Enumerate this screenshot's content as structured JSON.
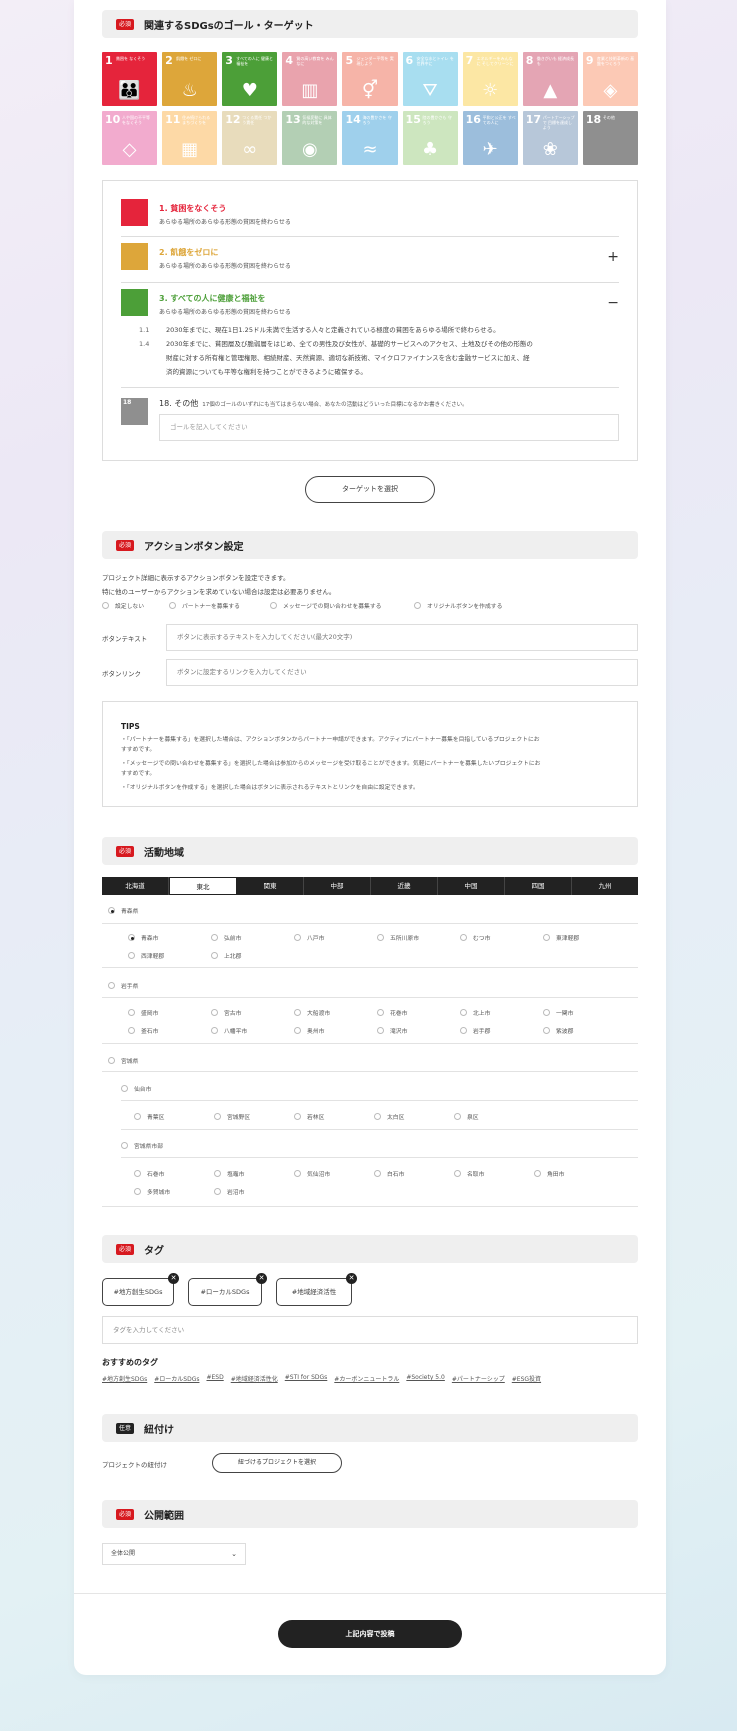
{
  "sections": {
    "sdgs": {
      "badge": "必須",
      "title": "関連するSDGsのゴール・ターゲット"
    },
    "action": {
      "badge": "必須",
      "title": "アクションボタン設定"
    },
    "area": {
      "badge": "必須",
      "title": "活動地域"
    },
    "tags": {
      "badge": "必須",
      "title": "タグ"
    },
    "link": {
      "badge": "任意",
      "title": "紐付け"
    },
    "visibility": {
      "badge": "必須",
      "title": "公開範囲"
    }
  },
  "sdg_tiles": [
    {
      "num": "1",
      "label": "貧困を なくそう",
      "glyph": "👪",
      "color": "#e5243b"
    },
    {
      "num": "2",
      "label": "飢餓を ゼロに",
      "glyph": "♨",
      "color": "#dda63a"
    },
    {
      "num": "3",
      "label": "すべての人に 健康と福祉を",
      "glyph": "♥",
      "color": "#4c9f38"
    },
    {
      "num": "4",
      "label": "質の高い教育を みんなに",
      "glyph": "▥",
      "color": "#e9a3ad"
    },
    {
      "num": "5",
      "label": "ジェンダー平等を 実現しよう",
      "glyph": "⚥",
      "color": "#f6b4a8"
    },
    {
      "num": "6",
      "label": "安全な水とトイレ を世界中に",
      "glyph": "⛛",
      "color": "#a8def0"
    },
    {
      "num": "7",
      "label": "エネルギーをみんなに そしてクリーンに",
      "glyph": "☼",
      "color": "#fce7a4"
    },
    {
      "num": "8",
      "label": "働きがいも 経済成長も",
      "glyph": "▲",
      "color": "#e4a5b4"
    },
    {
      "num": "9",
      "label": "産業と技術革新の 基盤をつくろう",
      "glyph": "◈",
      "color": "#fcc9b5"
    },
    {
      "num": "10",
      "label": "人や国の不平等 をなくそう",
      "glyph": "◇",
      "color": "#f2abce"
    },
    {
      "num": "11",
      "label": "住み続けられる まちづくりを",
      "glyph": "▦",
      "color": "#fdd9a6"
    },
    {
      "num": "12",
      "label": "つくる責任 つかう責任",
      "glyph": "∞",
      "color": "#e8dcbc"
    },
    {
      "num": "13",
      "label": "気候変動に 具体的な対策を",
      "glyph": "◉",
      "color": "#b3cfb4"
    },
    {
      "num": "14",
      "label": "海の豊かさを 守ろう",
      "glyph": "≈",
      "color": "#9fd0ec"
    },
    {
      "num": "15",
      "label": "陸の豊かさも 守ろう",
      "glyph": "♣",
      "color": "#cde6bf"
    },
    {
      "num": "16",
      "label": "平和と公正を すべての人に",
      "glyph": "✈",
      "color": "#9cbedc"
    },
    {
      "num": "17",
      "label": "パートナーシップで 目標を達成しよう",
      "glyph": "❀",
      "color": "#b7c7d9"
    },
    {
      "num": "18",
      "label": "その他",
      "glyph": "",
      "color": "#8f8f8f"
    }
  ],
  "goals": [
    {
      "title": "1. 貧困をなくそう",
      "sub": "あらゆる場所のあらゆる形態の貧困を終わらせる",
      "color": "#e5243b",
      "toggle": ""
    },
    {
      "title": "2. 飢餓をゼロに",
      "sub": "あらゆる場所のあらゆる形態の貧困を終わらせる",
      "color": "#dda63a",
      "toggle": "+"
    },
    {
      "title": "3. すべての人に健康と福祉を",
      "sub": "あらゆる場所のあらゆる形態の貧困を終わらせる",
      "color": "#4c9f38",
      "toggle": "−"
    }
  ],
  "targets": [
    {
      "id": "1.1",
      "lines": [
        "2030年までに、現在1日1.25ドル未満で生活する人々と定義されている極度の貧困をあらゆる場所で終わらせる。"
      ]
    },
    {
      "id": "1.4",
      "lines": [
        "2030年までに、貧困層及び脆弱層をはじめ、全ての男性及び女性が、基礎的サービスへのアクセス、土地及びその他の形態の",
        "財産に対する所有権と管理権限、相続財産、天然資源、適切な新技術、マイクロファイナンスを含む金融サービスに加え、経",
        "済的資源についても平等な権利を持つことができるように確保する。"
      ]
    }
  ],
  "other_goal": {
    "tile": "18",
    "title": "18. その他",
    "note": "17個のゴールのいずれにも当てはまらない場合、あなたの活動はどういった目標になるかお書きください。",
    "placeholder": "ゴールを記入してください"
  },
  "select_target_button": "ターゲットを選択",
  "action": {
    "desc1": "プロジェクト詳細に表示するアクションボタンを設定できます。",
    "desc2": "特に他のユーザーからアクションを求めていない場合は設定は必要ありません。",
    "options": [
      "設定しない",
      "パートナーを募集する",
      "メッセージでの問い合わせを募集する",
      "オリジナルボタンを作成する"
    ],
    "text_label": "ボタンテキスト",
    "text_placeholder": "ボタンに表示するテキストを入力してください(最大20文字)",
    "link_label": "ボタンリンク",
    "link_placeholder": "ボタンに設定するリンクを入力してください"
  },
  "tips": {
    "title": "TIPS",
    "lines": [
      "・「パートナーを募集する」を選択した場合は、アクションボタンからパートナー申請ができます。アクティブにパートナー募集を目指しているプロジェクトにお",
      "すすめです。",
      "・「メッセージでの問い合わせを募集する」を選択した場合は参加からのメッセージを受け取ることができます。気軽にパートナーを募集したいプロジェクトにお",
      "すすめです。",
      "・「オリジナルボタンを作成する」を選択した場合はボタンに表示されるテキストとリンクを自由に設定できます。"
    ]
  },
  "regions": [
    "北海道",
    "東北",
    "関東",
    "中部",
    "近畿",
    "中国",
    "四国",
    "九州"
  ],
  "prefectures": {
    "aomori": {
      "name": "青森県",
      "cities": [
        "青森市",
        "弘前市",
        "八戸市",
        "五所川原市",
        "むつ市",
        "東津軽郡",
        "西津軽郡",
        "上北郡"
      ]
    },
    "iwate": {
      "name": "岩手県",
      "cities": [
        "盛岡市",
        "宮古市",
        "大船渡市",
        "花巻市",
        "北上市",
        "一関市",
        "釜石市",
        "八幡平市",
        "奥州市",
        "滝沢市",
        "岩手郡",
        "紫波郡"
      ]
    },
    "miyagi": {
      "name": "宮城県",
      "sendai": "仙台市",
      "sendai_wards": [
        "青葉区",
        "宮城野区",
        "若林区",
        "太白区",
        "泉区"
      ],
      "other_label": "宮城県市部",
      "other_cities": [
        "石巻市",
        "塩竈市",
        "気仙沼市",
        "白石市",
        "名取市",
        "角田市",
        "多賀城市",
        "岩沼市"
      ]
    }
  },
  "tags": {
    "chips": [
      "#地方創生SDGs",
      "#ローカルSDGs",
      "#地域経済活性"
    ],
    "placeholder": "タグを入力してください",
    "rec_title": "おすすめのタグ",
    "recommended": [
      "#地方創生SDGs",
      "#ローカルSDGs",
      "#ESD",
      "#地域経済活性化",
      "#STI for SDGs",
      "#カーボンニュートラル",
      "#Society 5.0",
      "#パートナーシップ",
      "#ESG投資"
    ]
  },
  "link": {
    "label": "プロジェクトの紐付け",
    "button": "紐づけるプロジェクトを選択"
  },
  "visibility": {
    "selected": "全体公開"
  },
  "submit": "上記内容で投稿",
  "colors": {
    "required": "#d7191f",
    "dark": "#222222"
  },
  "icons": {
    "close": "close-icon",
    "caret": "chevron-down-icon"
  }
}
